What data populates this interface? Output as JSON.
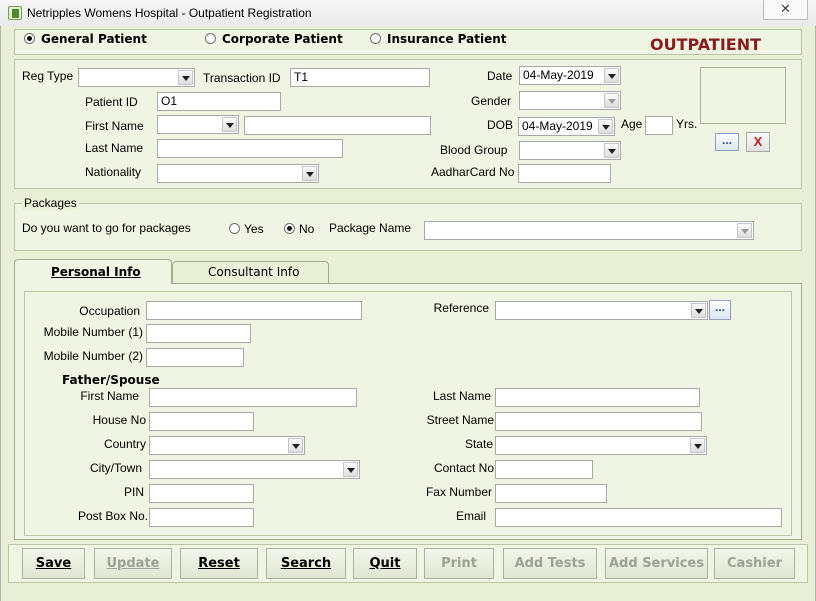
{
  "window": {
    "title": "Netripples Womens Hospital - Outpatient Registration",
    "close_symbol": "✕"
  },
  "patient_type": {
    "options": [
      {
        "label": "General Patient",
        "selected": true
      },
      {
        "label": "Corporate Patient",
        "selected": false
      },
      {
        "label": "Insurance Patient",
        "selected": false
      }
    ],
    "banner": "OUTPATIENT"
  },
  "registration": {
    "reg_type_label": "Reg Type",
    "reg_type_value": "",
    "transaction_id_label": "Transaction ID",
    "transaction_id_value": "T1",
    "date_label": "Date",
    "date_value": "04-May-2019",
    "patient_id_label": "Patient ID",
    "patient_id_value": "O1",
    "gender_label": "Gender",
    "gender_value": "",
    "first_name_label": "First Name",
    "first_name_title": "",
    "first_name_value": "",
    "dob_label": "DOB",
    "dob_value": "04-May-2019",
    "age_label": "Age",
    "age_value": "",
    "yrs_label": "Yrs.",
    "last_name_label": "Last Name",
    "last_name_value": "",
    "blood_group_label": "Blood Group",
    "blood_group_value": "",
    "nationality_label": "Nationality",
    "nationality_value": "",
    "aadhar_label": "AadharCard No",
    "aadhar_value": "",
    "browse_button": "...",
    "clear_button": "X"
  },
  "packages": {
    "title": "Packages",
    "question": "Do you want to go for packages",
    "yes_label": "Yes",
    "no_label": "No",
    "selected": "No",
    "package_name_label": "Package Name",
    "package_name_value": ""
  },
  "tabs": [
    {
      "label": "Personal Info",
      "active": true
    },
    {
      "label": "Consultant Info",
      "active": false
    }
  ],
  "personal": {
    "occupation_label": "Occupation",
    "occupation_value": "",
    "reference_label": "Reference",
    "reference_value": "",
    "reference_browse": "...",
    "mobile1_label": "Mobile Number (1)",
    "mobile1_value": "",
    "mobile2_label": "Mobile Number (2)",
    "mobile2_value": "",
    "father_spouse_heading": "Father/Spouse",
    "fs_first_name_label": "First Name",
    "fs_first_name_value": "",
    "fs_last_name_label": "Last Name",
    "fs_last_name_value": "",
    "house_no_label": "House No",
    "house_no_value": "",
    "street_name_label": "Street Name",
    "street_name_value": "",
    "country_label": "Country",
    "country_value": "",
    "state_label": "State",
    "state_value": "",
    "city_label": "City/Town",
    "city_value": "",
    "contact_no_label": "Contact No",
    "contact_no_value": "",
    "pin_label": "PIN",
    "pin_value": "",
    "fax_label": "Fax Number",
    "fax_value": "",
    "post_box_label": "Post Box No.",
    "post_box_value": "",
    "email_label": "Email",
    "email_value": ""
  },
  "actions": [
    {
      "label": "Save",
      "enabled": true
    },
    {
      "label": "Update",
      "enabled": false
    },
    {
      "label": "Reset",
      "enabled": true
    },
    {
      "label": "Search",
      "enabled": true
    },
    {
      "label": "Quit",
      "enabled": true
    },
    {
      "label": "Print",
      "enabled": false
    },
    {
      "label": "Add Tests",
      "enabled": false
    },
    {
      "label": "Add Services",
      "enabled": false
    },
    {
      "label": "Cashier",
      "enabled": false
    }
  ],
  "colors": {
    "banner": "#8b1a1a",
    "panel": "#eff5e2",
    "accent_button": "#2a4fa0"
  }
}
